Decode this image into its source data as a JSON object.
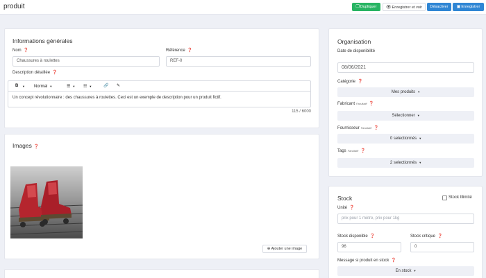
{
  "header": {
    "title": "produit",
    "buttons": {
      "duplicate": "Dupliquer",
      "save_view": "Enregistrer et voir",
      "deactivate": "Désactiver",
      "save": "Enregistrer"
    }
  },
  "general": {
    "title": "Informations générales",
    "name_label": "Nom",
    "name_value": "Chaussures à roulettes",
    "reference_label": "Référence",
    "reference_value": "REF-0",
    "description_label": "Description détaillée",
    "toolbar": {
      "bold": "B",
      "style": "Normal"
    },
    "description_text": "Un concept révolutionnaire : des chaussures à roulettes. Ceci est un exemple de description pour un produit fictif.",
    "char_counter": "115 / 6000"
  },
  "images": {
    "title": "Images",
    "add_button": "Ajouter une image"
  },
  "organisation": {
    "title": "Organisation",
    "date_label": "Date de disponibilité",
    "date_value": "08/06/2021",
    "category_label": "Catégorie",
    "category_value": "Mes produits",
    "manufacturer_label": "Fabricant",
    "manufacturer_optional": "Facultatif",
    "manufacturer_value": "Sélectionner",
    "supplier_label": "Fournisseur",
    "supplier_optional": "Facultatif",
    "supplier_value": "0 selectionnés",
    "tags_label": "Tags",
    "tags_optional": "Facultatif",
    "tags_value": "2 selectionnés"
  },
  "stock": {
    "title": "Stock",
    "unlimited_label": "Stock Illimité",
    "unlimited_checked": false,
    "unit_label": "Unité",
    "unit_placeholder": "prix pour 1 mètre, prix pour 1kg",
    "available_label": "Stock disponible",
    "available_value": "96",
    "critical_label": "Stock critique",
    "critical_value": "0",
    "message_label": "Message si produit en stock",
    "message_value": "En stock"
  },
  "colors": {
    "success": "#28b463",
    "primary": "#2f86d4",
    "background": "#eef0f6"
  }
}
